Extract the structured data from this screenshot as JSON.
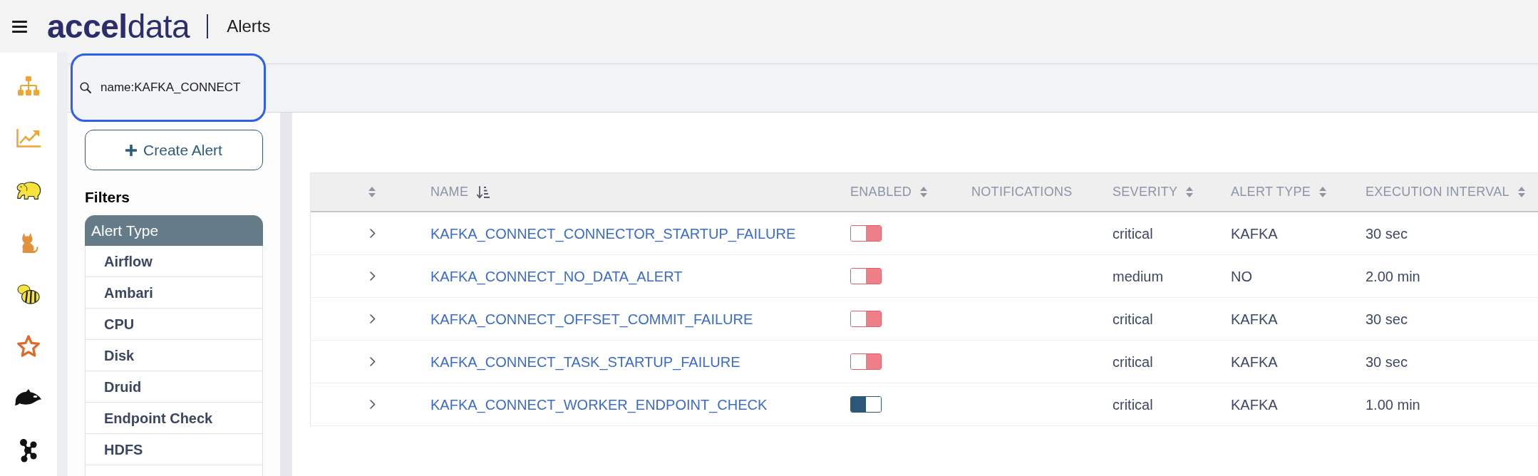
{
  "header": {
    "logo": "**accel**data",
    "title": "Alerts"
  },
  "search": {
    "value": "name:KAFKA_CONNECT",
    "highlighted": true
  },
  "create_button": {
    "label": "Create Alert"
  },
  "filters": {
    "title": "Filters",
    "groups": [
      {
        "title": "Alert Type",
        "items": [
          "Airflow",
          "Ambari",
          "CPU",
          "Disk",
          "Druid",
          "Endpoint Check",
          "HDFS"
        ]
      }
    ]
  },
  "table": {
    "columns": [
      {
        "sortable": true,
        "sorted": false
      },
      {
        "label": "NAME",
        "sortable": true,
        "sorted": true
      },
      {
        "label": "ENABLED",
        "sortable": true,
        "sorted": false
      },
      {
        "label": "NOTIFICATIONS",
        "sortable": false
      },
      {
        "label": "SEVERITY",
        "sortable": true,
        "sorted": false
      },
      {
        "label": "ALERT TYPE",
        "sortable": true,
        "sorted": false
      },
      {
        "label": "EXECUTION INTERVAL",
        "sortable": true,
        "sorted": false
      }
    ],
    "rows": [
      {
        "expanded": false,
        "name": "KAFKA_CONNECT_CONNECTOR_STARTUP_FAILURE",
        "enabled": false,
        "severity": "critical",
        "alert_type": "KAFKA",
        "execution_interval": "30 sec"
      },
      {
        "expanded": false,
        "name": "KAFKA_CONNECT_NO_DATA_ALERT",
        "enabled": false,
        "severity": "medium",
        "alert_type": "NO",
        "execution_interval": "2.00 min"
      },
      {
        "expanded": false,
        "name": "KAFKA_CONNECT_OFFSET_COMMIT_FAILURE",
        "enabled": false,
        "severity": "critical",
        "alert_type": "KAFKA",
        "execution_interval": "30 sec"
      },
      {
        "expanded": false,
        "name": "KAFKA_CONNECT_TASK_STARTUP_FAILURE",
        "enabled": false,
        "severity": "critical",
        "alert_type": "KAFKA",
        "execution_interval": "30 sec"
      },
      {
        "expanded": false,
        "name": "KAFKA_CONNECT_WORKER_ENDPOINT_CHECK",
        "enabled": true,
        "severity": "critical",
        "alert_type": "KAFKA",
        "execution_interval": "1.00 min"
      }
    ]
  }
}
